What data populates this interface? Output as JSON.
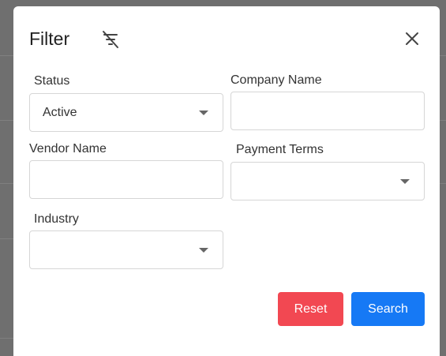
{
  "dialog": {
    "title": "Filter",
    "filter_icon": "filter-off-icon",
    "close_icon": "close-icon"
  },
  "fields": {
    "status": {
      "label": "Status",
      "value": "Active"
    },
    "company_name": {
      "label": "Company Name",
      "value": ""
    },
    "vendor_name": {
      "label": "Vendor Name",
      "value": ""
    },
    "payment_terms": {
      "label": "Payment Terms",
      "value": ""
    },
    "industry": {
      "label": "Industry",
      "value": ""
    }
  },
  "actions": {
    "reset_label": "Reset",
    "search_label": "Search"
  },
  "colors": {
    "reset": "#f24852",
    "search": "#1679f5",
    "overlay": "#6f6f6f"
  }
}
